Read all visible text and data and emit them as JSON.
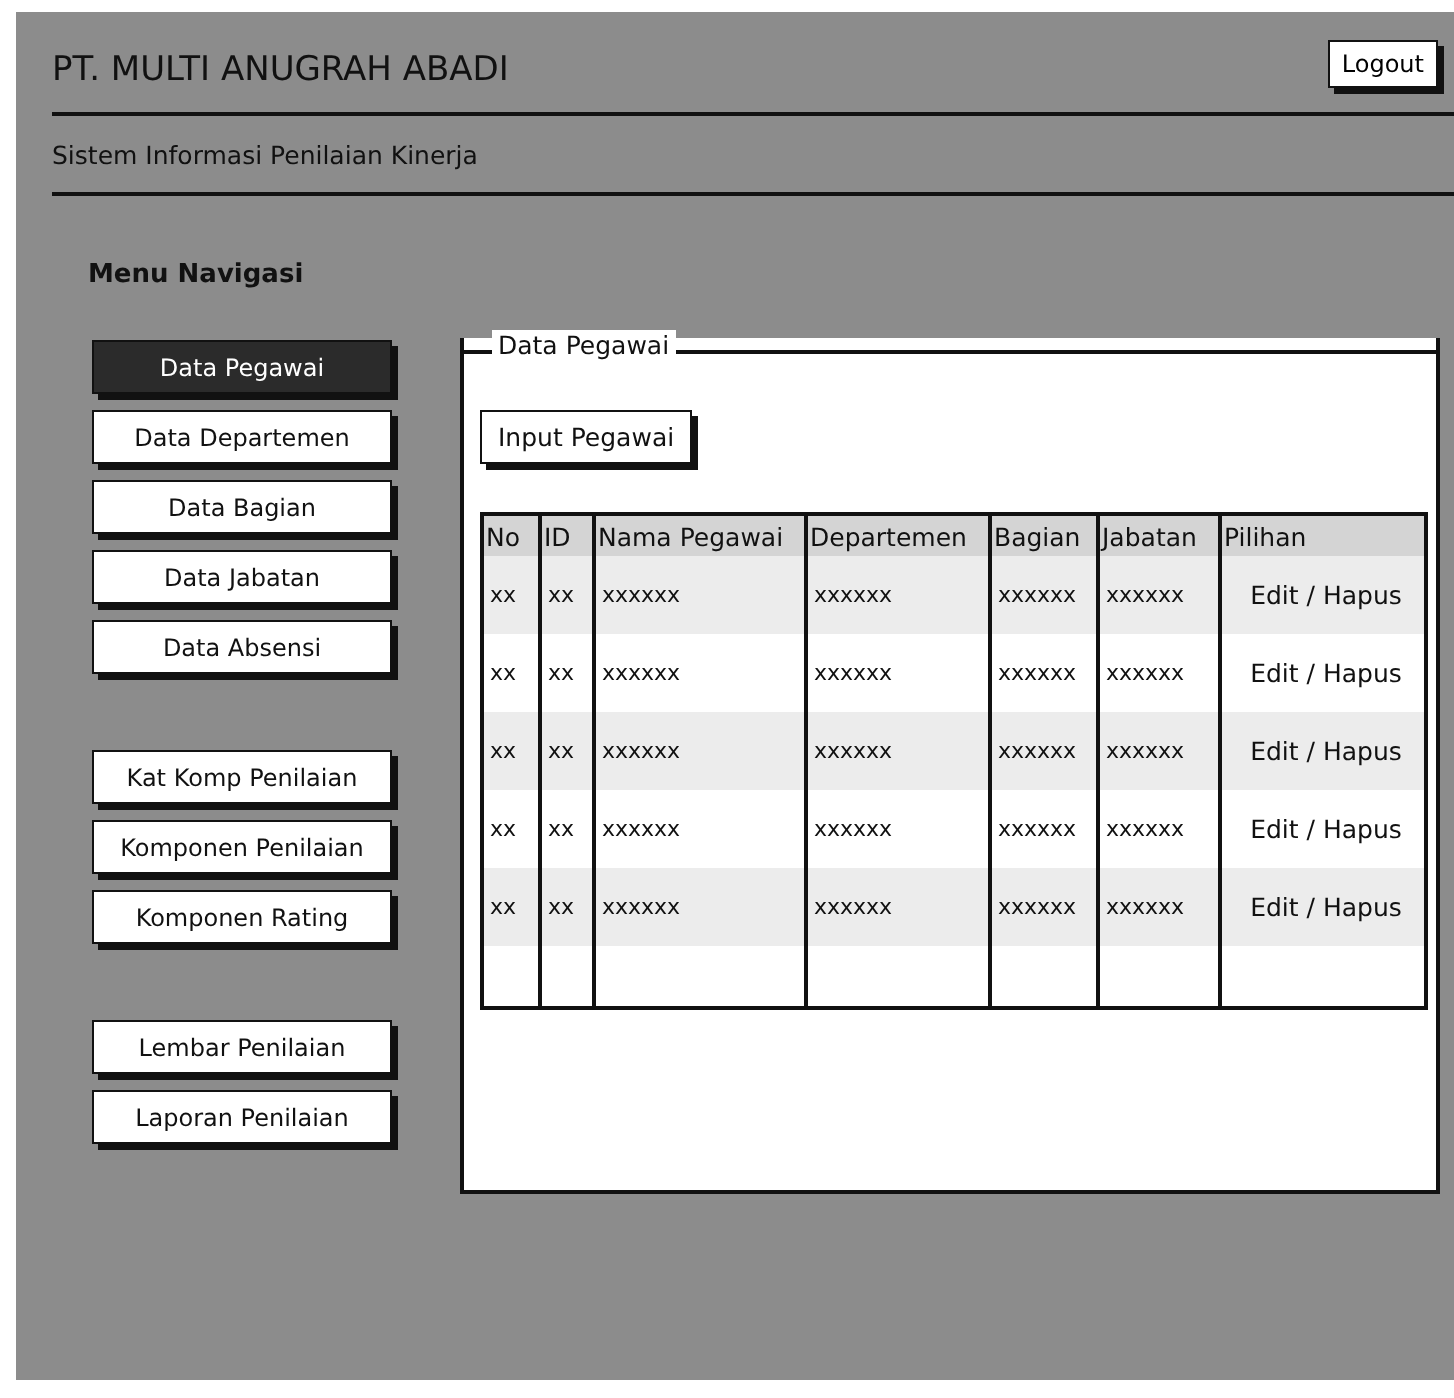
{
  "header": {
    "title": "PT. MULTI ANUGRAH ABADI",
    "logout_button": "Logout",
    "subtitle": "Sistem Informasi Penilaian Kinerja"
  },
  "navigation": {
    "title": "Menu Navigasi",
    "groups": [
      [
        {
          "label": "Data Pegawai",
          "selected": true
        },
        {
          "label": "Data Departemen",
          "selected": false
        },
        {
          "label": "Data Bagian",
          "selected": false
        },
        {
          "label": "Data Jabatan",
          "selected": false
        },
        {
          "label": "Data Absensi",
          "selected": false
        }
      ],
      [
        {
          "label": "Kat Komp Penilaian",
          "selected": false
        },
        {
          "label": "Komponen Penilaian",
          "selected": false
        },
        {
          "label": "Komponen Rating",
          "selected": false
        }
      ],
      [
        {
          "label": "Lembar Penilaian",
          "selected": false
        },
        {
          "label": "Laporan Penilaian",
          "selected": false
        }
      ]
    ]
  },
  "panel": {
    "title": "Data Pegawai",
    "input_button": "Input Pegawai",
    "table": {
      "columns": [
        "No",
        "ID",
        "Nama Pegawai",
        "Departemen",
        "Bagian",
        "Jabatan",
        "Pilihan"
      ],
      "rows": [
        [
          "xx",
          "xx",
          "xxxxxx",
          "xxxxxx",
          "xxxxxx",
          "xxxxxx",
          "Edit / Hapus"
        ],
        [
          "xx",
          "xx",
          "xxxxxx",
          "xxxxxx",
          "xxxxxx",
          "xxxxxx",
          "Edit / Hapus"
        ],
        [
          "xx",
          "xx",
          "xxxxxx",
          "xxxxxx",
          "xxxxxx",
          "xxxxxx",
          "Edit / Hapus"
        ],
        [
          "xx",
          "xx",
          "xxxxxx",
          "xxxxxx",
          "xxxxxx",
          "xxxxxx",
          "Edit / Hapus"
        ],
        [
          "xx",
          "xx",
          "xxxxxx",
          "xxxxxx",
          "xxxxxx",
          "xxxxxx",
          "Edit / Hapus"
        ]
      ]
    }
  }
}
